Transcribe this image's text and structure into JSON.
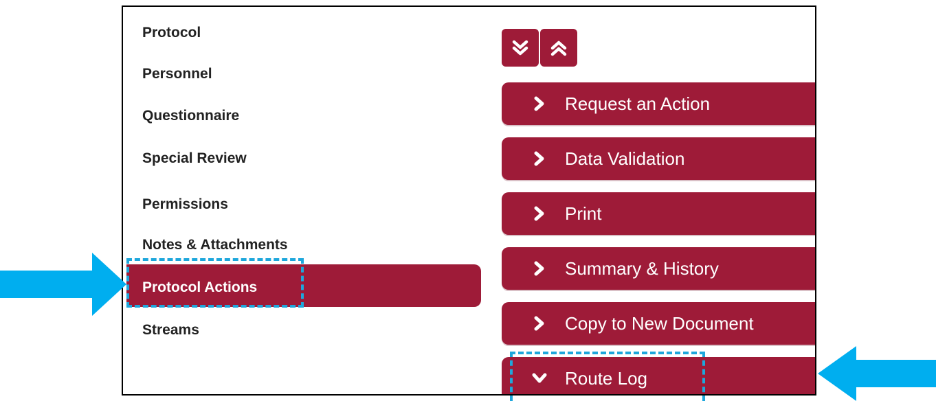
{
  "nav": {
    "items": [
      {
        "label": "Protocol"
      },
      {
        "label": "Personnel"
      },
      {
        "label": "Questionnaire"
      },
      {
        "label": "Special Review"
      },
      {
        "label": "Permissions"
      },
      {
        "label": "Notes & Attachments"
      },
      {
        "label": "Protocol Actions",
        "active": true
      },
      {
        "label": "Streams"
      }
    ]
  },
  "panels": {
    "items": [
      {
        "label": "Request an Action",
        "expanded": false
      },
      {
        "label": "Data Validation",
        "expanded": false
      },
      {
        "label": "Print",
        "expanded": false
      },
      {
        "label": "Summary & History",
        "expanded": false
      },
      {
        "label": "Copy to New Document",
        "expanded": false
      },
      {
        "label": "Route Log",
        "expanded": true
      }
    ]
  },
  "toolbar": {
    "expand_all_icon": "double-chevron-down-icon",
    "collapse_all_icon": "double-chevron-up-icon"
  },
  "colors": {
    "brand": "#9e1b38",
    "highlight": "#1ea7dc"
  }
}
